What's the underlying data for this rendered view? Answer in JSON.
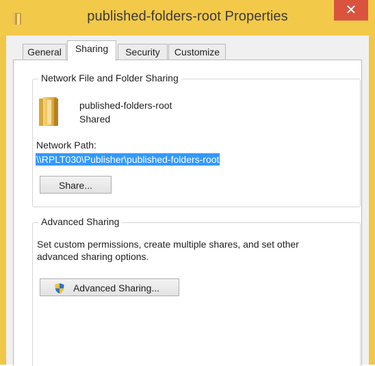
{
  "window": {
    "title": "published-folders-root Properties",
    "close_glyph": "✕",
    "folder_icon": "folder-icon",
    "accent": "#f3c94a"
  },
  "tabs": [
    {
      "label": "General"
    },
    {
      "label": "Sharing",
      "active": true
    },
    {
      "label": "Security"
    },
    {
      "label": "Customize"
    }
  ],
  "network_sharing": {
    "group_label": "Network File and Folder Sharing",
    "folder_name": "published-folders-root",
    "status": "Shared",
    "path_label": "Network Path:",
    "path_value": "\\\\RPLT030\\Publisher\\published-folders-root",
    "share_button": "Share..."
  },
  "advanced_sharing": {
    "group_label": "Advanced Sharing",
    "description_line1": "Set custom permissions, create multiple shares, and set other",
    "description_line2": "advanced sharing options.",
    "button_label": "Advanced Sharing...",
    "button_icon": "uac-shield-icon"
  }
}
